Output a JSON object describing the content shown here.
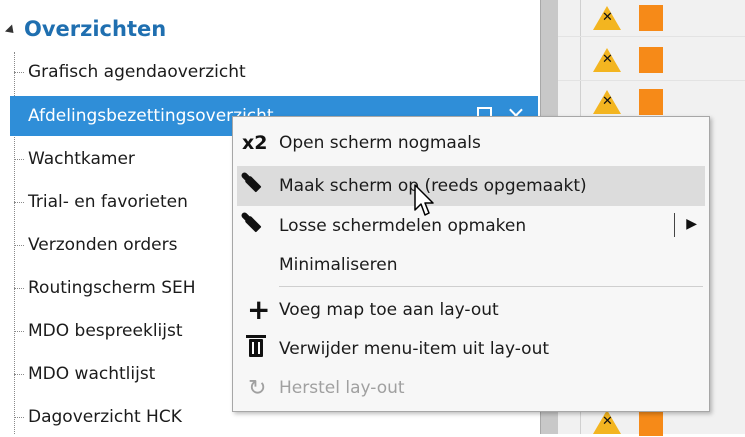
{
  "tree": {
    "section_title": "Overzichten",
    "items": [
      {
        "label": "Grafisch agendaoverzicht"
      },
      {
        "label": "Afdelingsbezettingsoverzicht",
        "selected": true
      },
      {
        "label": "Wachtkamer"
      },
      {
        "label": "Trial- en favorieten"
      },
      {
        "label": "Verzonden orders"
      },
      {
        "label": "Routingscherm SEH"
      },
      {
        "label": "MDO bespreeklijst"
      },
      {
        "label": "MDO wachtlijst"
      },
      {
        "label": "Dagoverzicht HCK"
      }
    ]
  },
  "context_menu": {
    "items": [
      {
        "label": "Open scherm nogmaals",
        "icon": "x2-icon"
      },
      {
        "label": "Maak scherm op (reeds opgemaakt)",
        "icon": "brush-icon",
        "hovered": true
      },
      {
        "label": "Losse schermdelen opmaken",
        "icon": "brush-icon",
        "has_submenu": true
      },
      {
        "label": "Minimaliseren",
        "icon": ""
      },
      {
        "label": "Voeg map toe aan lay-out",
        "icon": "plus-icon"
      },
      {
        "label": "Verwijder menu-item uit lay-out",
        "icon": "trash-icon"
      },
      {
        "label": "Herstel lay-out",
        "icon": "refresh-icon",
        "disabled": true
      }
    ],
    "x2_glyph": "x2"
  },
  "colors": {
    "accent": "#1f6fb0",
    "selection": "#2f8ed8",
    "warning": "#f3b520",
    "status_orange": "#f68a18"
  }
}
